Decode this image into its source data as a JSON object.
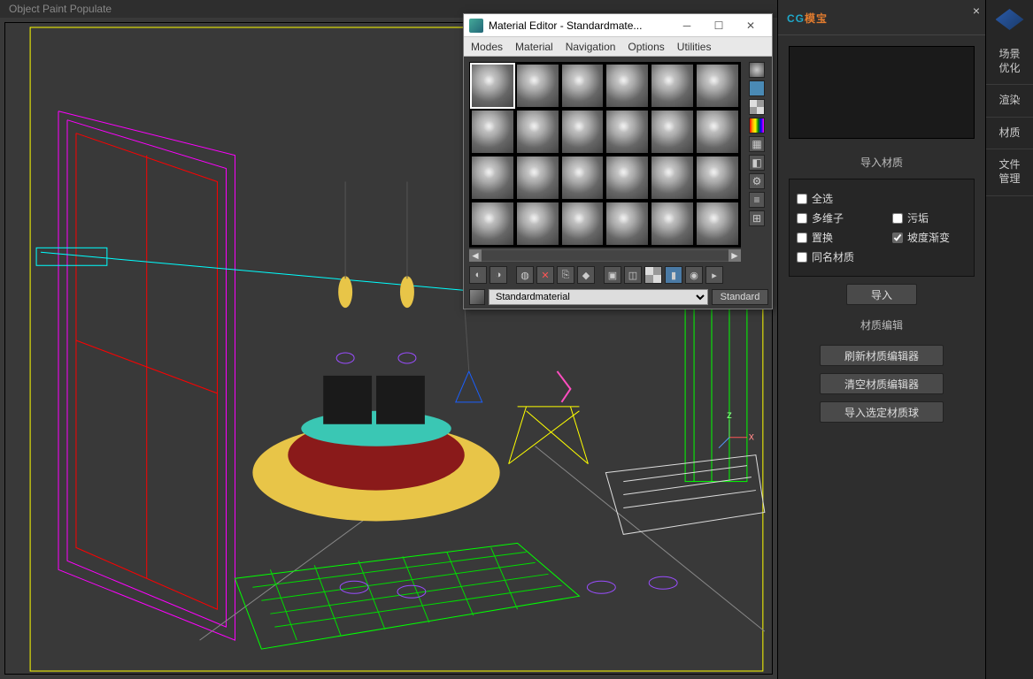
{
  "topbar": {
    "left_text": "Object Paint    Populate"
  },
  "material_editor": {
    "title": "Material Editor - Standardmate...",
    "menu": [
      "Modes",
      "Material",
      "Navigation",
      "Options",
      "Utilities"
    ],
    "material_name": "Standardmaterial",
    "type_button": "Standard",
    "slot_rows": 4,
    "slot_cols": 6,
    "active_slot": 0
  },
  "cg_panel": {
    "brand": "CG模宝",
    "close": "×",
    "import_section": "导入材质",
    "checks": {
      "select_all": "全选",
      "multi_sub": "多维子",
      "dirt": "污垢",
      "displace": "置换",
      "slope_grad": "坡度渐变",
      "same_name": "同名材质"
    },
    "checked": {
      "slope_grad": true
    },
    "import_btn": "导入",
    "edit_section": "材质编辑",
    "refresh_btn": "刷新材质编辑器",
    "clear_btn": "清空材质编辑器",
    "import_selected_btn": "导入选定材质球"
  },
  "right_tabs": {
    "items": [
      {
        "id": "scene_opt",
        "label": "场景\n优化"
      },
      {
        "id": "render",
        "label": "渲染"
      },
      {
        "id": "material",
        "label": "材质"
      },
      {
        "id": "file_mgmt",
        "label": "文件\n管理"
      }
    ]
  }
}
